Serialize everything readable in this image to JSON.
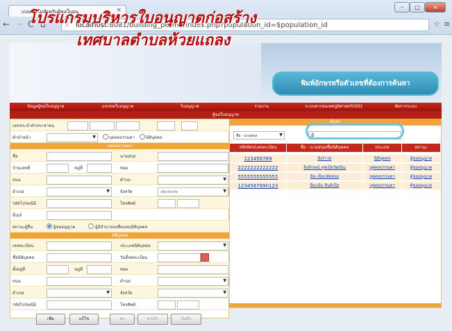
{
  "browser": {
    "tab_title": "แบบฟอร์มสำหรับผู้ขอใบอนุ",
    "url_host": "localhost",
    "url_rest": ":8081/building_permit/index.php?population_id=$population_id"
  },
  "banner": {
    "title1": "โปรแกรมบริหารใบอนุญาตก่อสร้าง",
    "title2": "เทศบาลตำบลห้วยแถลง"
  },
  "callout": "พิมพ์อักษรหรือตัวเลขที่ต้องการค้นหา",
  "menu": [
    "ข้อมูลผู้ขอใบอนุญาต",
    "แบบขอใบอนุญาต",
    "ใบอนุญาต",
    "รายงาน",
    "ระบบสารสนเทศภูมิศาสตร์(GIS)",
    "จัดการระบบ"
  ],
  "subhead": "ผู้ขอใบอนุญาต",
  "form": {
    "id_label": "เลขประจำตัวประชาชน",
    "prefix_label": "คำนำหน้า",
    "radio_person": "บุคคลธรรมดา",
    "radio_juristic": "นิติบุคคล",
    "sec_person": "บุคคลธรรมดา",
    "name": "ชื่อ",
    "surname": "นามสกุล",
    "house_no": "บ้านเลขที่",
    "moo": "หมู่ที่",
    "soi": "ซอย",
    "road": "ถนน",
    "tambon": "ตำบล",
    "amphoe": "อำเภอ",
    "province": "จังหวัด",
    "province_value": "เลือกจังหวัด",
    "zip": "รหัสไปรษณีย์",
    "phone": "โทรศัพท์",
    "email": "อีเมล์",
    "status_label": "สถานะผู้ยื่น",
    "status_applicant": "ผู้ขออนุญาต",
    "status_agent": "ผู้มีอำนาจลงชื่อแทนนิติบุคคล",
    "sec_juristic": "นิติบุคคล",
    "reg_no": "เลขทะเบียน",
    "juristic_type": "ประเภทนิติบุคคล",
    "juristic_name": "ชื่อนิติบุคคล",
    "reg_date": "วันที่จดทะเบียน",
    "location": "ตั้งอยู่ที่"
  },
  "buttons": [
    "เพิ่ม",
    "แก้ไข",
    "ลบ",
    "ยกเลิก",
    "บันทึก"
  ],
  "right": {
    "header": "ค้นหา",
    "search_select": "ชื่อ - นามสกุล",
    "search_value": "อิ",
    "columns": [
      "รหัสบัตร/เลขทะเบียน",
      "ชื่อ - นามสกุล/ชื่อนิติบุคคล",
      "ประเภท",
      "สถานะ"
    ],
    "rows": [
      [
        "123456789",
        "อิงร่าวจ",
        "นิติบุคคล",
        "ผู้ขออนุญาต"
      ],
      [
        "2222222222222",
        "อิงลักษณ์ อุชเนียวัฒนิญ",
        "บุคคลธรรมดา",
        "ผู้ขออนุญาต"
      ],
      [
        "5555555555555",
        "อิด เข็มกลัดทอง",
        "บุคคลธรรมดา",
        "ผู้ขออนุญาต"
      ],
      [
        "1234567890123",
        "อิ่มแย้ม อินดิเนีย",
        "บุคคลธรรมดา",
        "ผู้ขออนุญาต"
      ]
    ]
  }
}
